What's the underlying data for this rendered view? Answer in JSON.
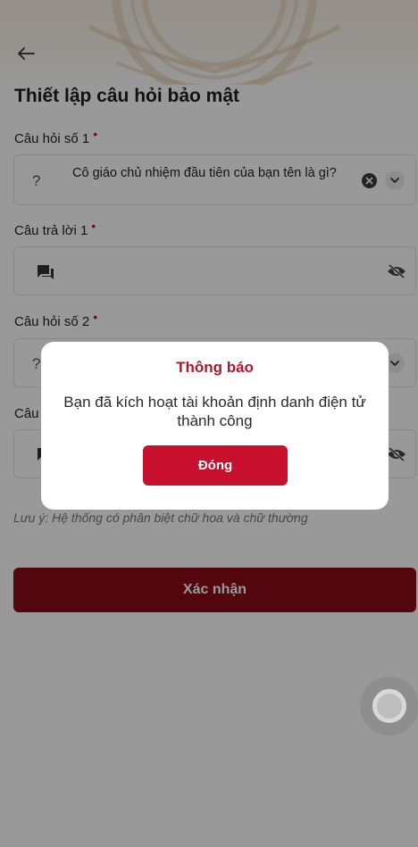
{
  "header": {
    "back_icon": "arrow-left-icon",
    "title": "Thiết lập câu hỏi bảo mật"
  },
  "form": {
    "required_mark": "•",
    "question1": {
      "label": "Câu hỏi số 1",
      "prefix": "?",
      "value": "Cô giáo chủ nhiệm đầu tiên của bạn tên là gì?"
    },
    "answer1": {
      "label": "Câu trả lời 1"
    },
    "question2": {
      "label": "Câu hỏi số 2",
      "prefix": "?"
    },
    "answer2": {
      "label_partial": "Câu"
    },
    "note": "Lưu ý: Hệ thống có phân biệt chữ hoa và chữ thường",
    "submit_label": "Xác nhận"
  },
  "dialog": {
    "title": "Thông báo",
    "message": "Bạn đã kích hoạt tài khoản định danh điện tử thành công",
    "button_label": "Đóng"
  },
  "colors": {
    "primary_red": "#c8102e",
    "submit_dark_red": "#8b0b18",
    "dialog_title_red": "#b3162b",
    "overlay": "rgba(0,0,0,0.40)"
  }
}
